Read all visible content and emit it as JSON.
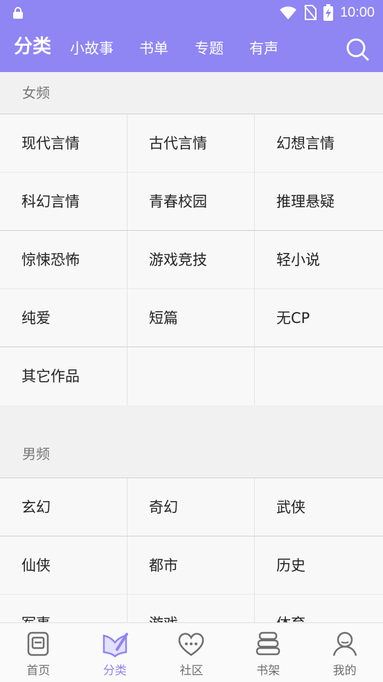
{
  "status_bar": {
    "time": "10:00"
  },
  "header": {
    "tabs": [
      {
        "label": "分类",
        "active": true
      },
      {
        "label": "小故事"
      },
      {
        "label": "书单"
      },
      {
        "label": "专题"
      },
      {
        "label": "有声"
      }
    ],
    "search_icon": "search-icon"
  },
  "sections": [
    {
      "title": "女频",
      "items": [
        "现代言情",
        "古代言情",
        "幻想言情",
        "科幻言情",
        "青春校园",
        "推理悬疑",
        "惊悚恐怖",
        "游戏竞技",
        "轻小说",
        "纯爱",
        "短篇",
        "无CP",
        "其它作品"
      ]
    },
    {
      "title": "男频",
      "items": [
        "玄幻",
        "奇幻",
        "武侠",
        "仙侠",
        "都市",
        "历史",
        "军事",
        "游戏",
        "体育"
      ]
    }
  ],
  "bottom_nav": [
    {
      "label": "首页",
      "icon": "home-book-icon"
    },
    {
      "label": "分类",
      "icon": "category-pen-icon",
      "active": true
    },
    {
      "label": "社区",
      "icon": "community-heart-icon"
    },
    {
      "label": "书架",
      "icon": "bookshelf-icon"
    },
    {
      "label": "我的",
      "icon": "profile-icon"
    }
  ],
  "colors": {
    "accent": "#8f85f3"
  }
}
